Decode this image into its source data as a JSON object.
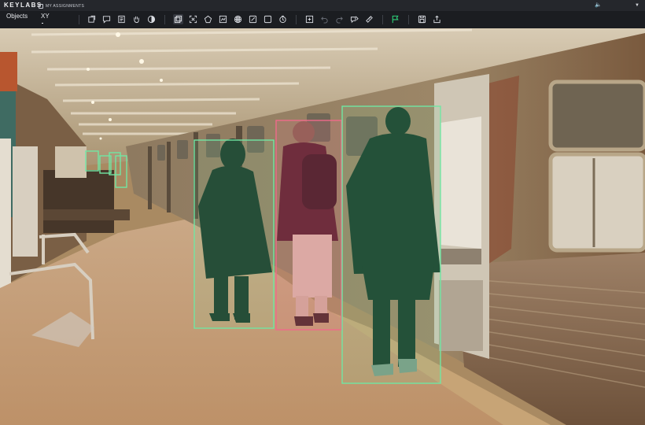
{
  "header": {
    "logo": "KEYLABS",
    "assignments_label": "MY ASSIGNMENTS"
  },
  "toolbar": {
    "tabs": [
      {
        "label": "Objects"
      },
      {
        "label": "XY"
      }
    ],
    "tools": [
      {
        "icon": "new-object-icon"
      },
      {
        "icon": "comment-icon"
      },
      {
        "icon": "notes-icon"
      },
      {
        "icon": "pan-hand-icon"
      },
      {
        "icon": "contrast-icon"
      },
      {
        "icon": "bounding-box-icon",
        "active": true
      },
      {
        "icon": "keypoints-icon"
      },
      {
        "icon": "polygon-icon"
      },
      {
        "icon": "polyline-icon"
      },
      {
        "icon": "mask-icon"
      },
      {
        "icon": "magic-icon"
      },
      {
        "icon": "cuboid-icon"
      },
      {
        "icon": "timer-icon"
      },
      {
        "icon": "add-frame-icon"
      },
      {
        "icon": "undo-icon"
      },
      {
        "icon": "redo-icon"
      },
      {
        "icon": "hide-icon"
      },
      {
        "icon": "ruler-icon"
      },
      {
        "icon": "flag-icon"
      },
      {
        "icon": "save-icon"
      },
      {
        "icon": "export-icon"
      }
    ]
  },
  "colors": {
    "topbar": "#25272c",
    "toolbar": "#1b1d21",
    "accent_green": "#2ecf78",
    "box_green": "#71e6a3",
    "box_red": "#f06a8b"
  },
  "annotations": [
    {
      "label_color": "green"
    },
    {
      "label_color": "red"
    },
    {
      "label_color": "green"
    },
    {
      "label_color": "green"
    },
    {
      "label_color": "green"
    },
    {
      "label_color": "green"
    },
    {
      "label_color": "green"
    }
  ]
}
